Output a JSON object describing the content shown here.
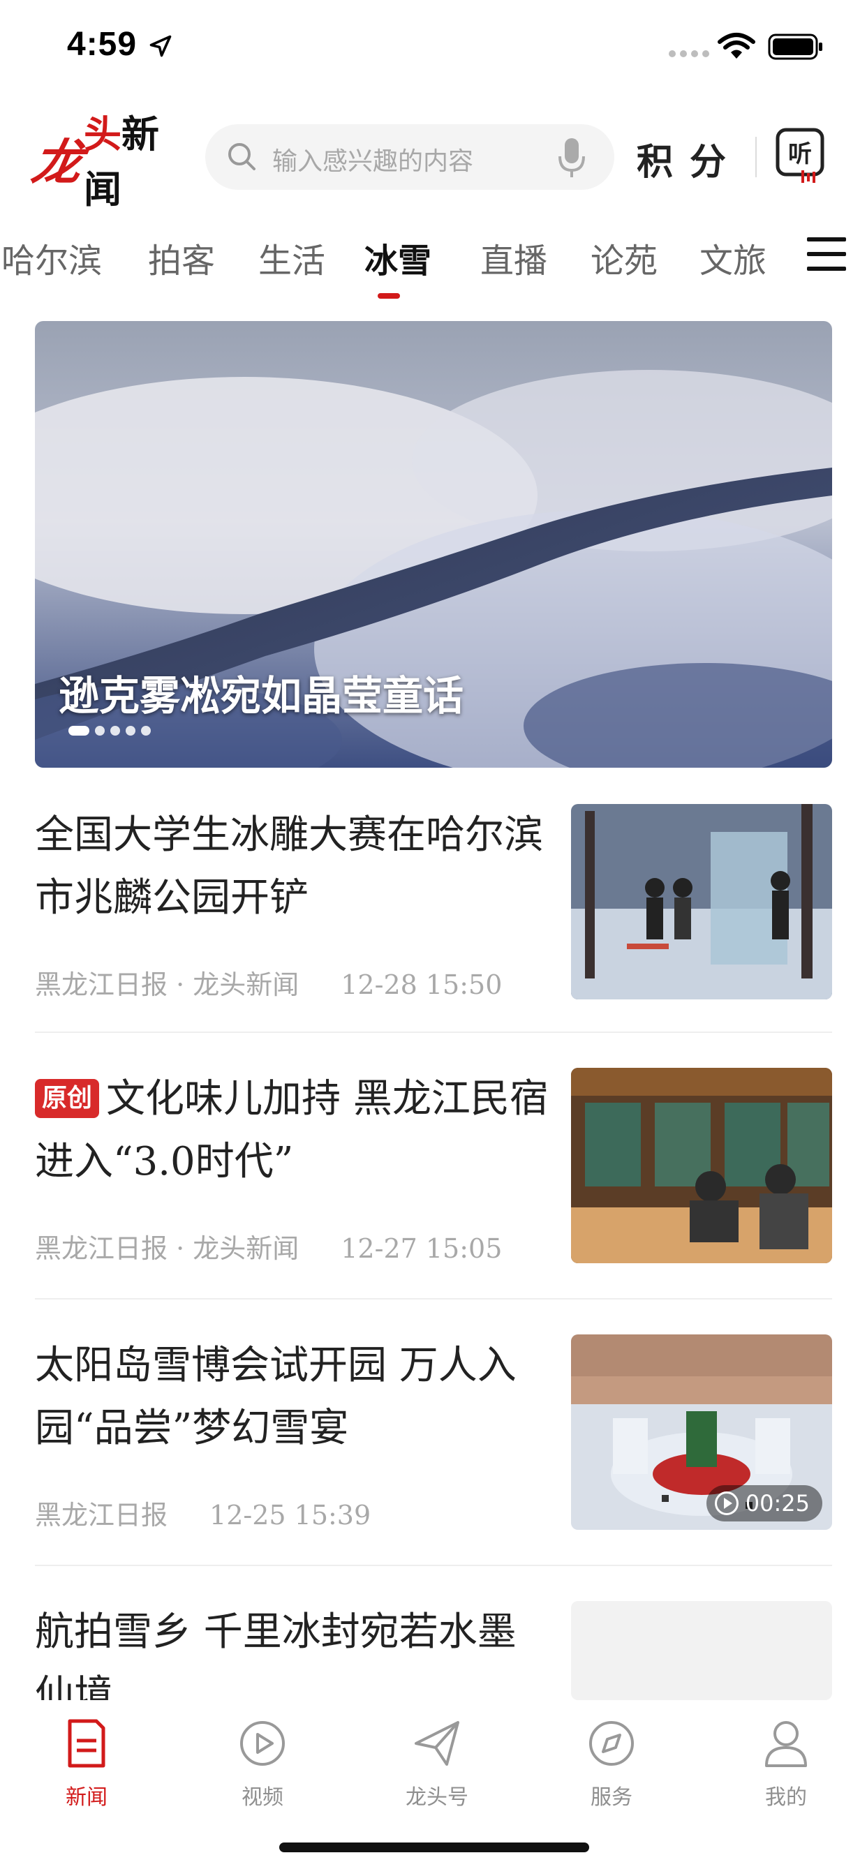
{
  "status_bar": {
    "time": "4:59"
  },
  "header": {
    "logo_mark": "龙",
    "logo_head": "头",
    "logo_news": "新闻",
    "search_placeholder": "输入感兴趣的内容",
    "points_label": "积分"
  },
  "tabs": [
    "哈尔滨",
    "拍客",
    "生活",
    "冰雪",
    "直播",
    "论苑",
    "文旅"
  ],
  "active_tab": "冰雪",
  "hero": {
    "title": "逊克雾凇宛如晶莹童话",
    "dots": 5,
    "active_dot": 1
  },
  "news": [
    {
      "title": "全国大学生冰雕大赛在哈尔滨市兆麟公园开铲",
      "source": "黑龙江日报 · 龙头新闻",
      "time": "12-28  15:50"
    },
    {
      "badge": "原创",
      "title": "文化味儿加持 黑龙江民宿进入“3.0时代”",
      "source": "黑龙江日报 · 龙头新闻",
      "time": "12-27  15:05"
    },
    {
      "title": "太阳岛雪博会试开园 万人入园“品尝”梦幻雪宴",
      "source": "黑龙江日报",
      "time": "12-25  15:39",
      "video_duration": "00:25"
    },
    {
      "title": "航拍雪乡 千里冰封宛若水墨仙境"
    }
  ],
  "bottom_nav": [
    {
      "label": "新闻",
      "icon": "news-icon",
      "active": true
    },
    {
      "label": "视频",
      "icon": "video-icon"
    },
    {
      "label": "龙头号",
      "icon": "paper-plane-icon"
    },
    {
      "label": "服务",
      "icon": "compass-icon"
    },
    {
      "label": "我的",
      "icon": "user-icon"
    }
  ],
  "colors": {
    "accent": "#d21a1a",
    "badge": "#d82a2a",
    "muted": "#a8a8a8"
  }
}
